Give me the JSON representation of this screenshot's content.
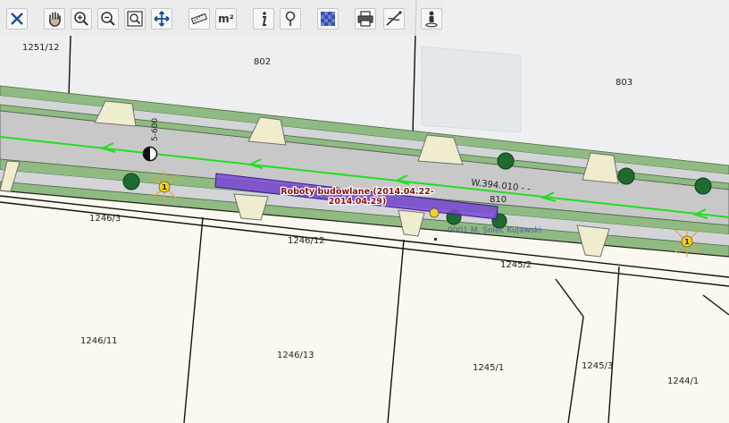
{
  "toolbar": {
    "tools": [
      "close",
      "pan",
      "zoom-in",
      "zoom-out",
      "zoom-window",
      "full-extent",
      "measure-length",
      "measure-area",
      "info",
      "identify",
      "layers",
      "print",
      "measure-profile",
      "street-view"
    ],
    "area_label": "m²"
  },
  "parcels": {
    "p1251_12": "1251/12",
    "p802": "802",
    "p803": "803",
    "p1246_3": "1246/3",
    "p1246_12": "1246/12",
    "p1245_2": "1245/2",
    "p1246_11": "1246/11",
    "p1246_13": "1246/13",
    "p1245_1": "1245/1",
    "p1245_3": "1245/3",
    "p1244_1": "1244/1",
    "p810": "810"
  },
  "road": {
    "label": "W.394.010 - -",
    "gauge_label": "5-600",
    "locality_label": "0001 M. Solec Kujawski"
  },
  "roadworks": {
    "line1": "Roboty budowlane (2014.04.22-",
    "line2": "2014.04.29)"
  },
  "markers": {
    "accident_count": "1"
  },
  "colors": {
    "background": "#fbf9ef",
    "road_gray": "#c8c8c8",
    "verge_green": "#8fba82",
    "sidewalk": "#d3d4d7",
    "road_axis": "#22dd22",
    "roadworks_fill": "#7b46d8",
    "roadworks_text": "#8b1010",
    "locality_text": "#5a5aa0",
    "accident_badge": "#f4d21a",
    "accident_star": "#f0a040"
  }
}
